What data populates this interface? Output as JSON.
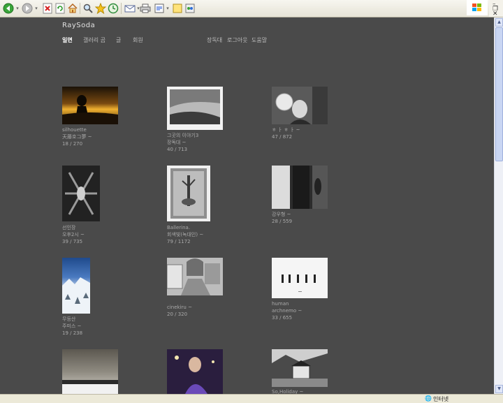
{
  "site": {
    "title": "RaySoda"
  },
  "nav": {
    "main": [
      "일면",
      "갤러리 곰",
      "글",
      "회원"
    ],
    "right": [
      "장독대",
      "로그아웃",
      "도움말"
    ]
  },
  "statusbar": {
    "zone": "인터넷"
  },
  "photos": [
    {
      "lines": [
        "silhouette",
        "天藤호コ夢 ~",
        "18 / 270"
      ]
    },
    {
      "lines": [
        "그곳의 이야기3",
        "장독대 ~",
        "40 / 713"
      ]
    },
    {
      "lines": [
        "ㅎ ㅏ ㅎ ㅏ ~",
        "47 / 872"
      ]
    },
    {
      "lines": [
        "선인장",
        "오후2시 ~",
        "39 / 735"
      ]
    },
    {
      "lines": [
        "Ballerina.",
        "회색빛(녹대인) ~",
        "79 / 1172"
      ]
    },
    {
      "lines": [
        "강우형 ~",
        "28 / 559"
      ]
    },
    {
      "lines": [
        "무등산",
        "주미스 ~",
        "19 / 238"
      ]
    },
    {
      "lines": [
        "cinekiru ~",
        "20 / 320"
      ]
    },
    {
      "lines": [
        "human",
        "archnemo ~",
        "33 / 655"
      ]
    },
    {
      "lines": []
    },
    {
      "lines": []
    },
    {
      "lines": [
        "So,Holiday ~"
      ]
    }
  ]
}
